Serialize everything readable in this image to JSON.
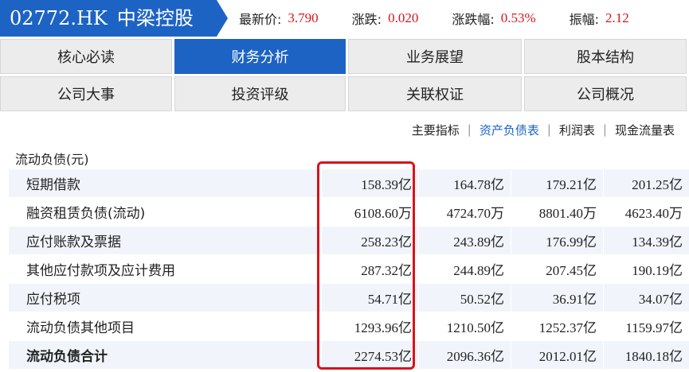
{
  "header": {
    "stock_code": "02772.HK",
    "stock_name": "中梁控股",
    "quotes": [
      {
        "label": "最新价:",
        "value": "3.790"
      },
      {
        "label": "涨跌:",
        "value": "0.020"
      },
      {
        "label": "涨跌幅:",
        "value": "0.53%"
      },
      {
        "label": "振幅:",
        "value": "2.12"
      }
    ]
  },
  "tabs": {
    "row1": [
      "核心必读",
      "财务分析",
      "业务展望",
      "股本结构"
    ],
    "row2": [
      "公司大事",
      "投资评级",
      "关联权证",
      "公司概况"
    ],
    "active": "财务分析"
  },
  "subnav": {
    "items": [
      "主要指标",
      "资产负债表",
      "利润表",
      "现金流量表"
    ],
    "separator": "|",
    "active": "资产负债表"
  },
  "table": {
    "section_title": "流动负债(元)",
    "rows": [
      {
        "label": "短期借款",
        "values": [
          "158.39亿",
          "164.78亿",
          "179.21亿",
          "201.25亿"
        ]
      },
      {
        "label": "融资租赁负债(流动)",
        "values": [
          "6108.60万",
          "4724.70万",
          "8801.40万",
          "4623.40万"
        ]
      },
      {
        "label": "应付账款及票据",
        "values": [
          "258.23亿",
          "243.89亿",
          "176.99亿",
          "134.39亿"
        ]
      },
      {
        "label": "其他应付款项及应计费用",
        "values": [
          "287.32亿",
          "244.89亿",
          "207.45亿",
          "190.19亿"
        ]
      },
      {
        "label": "应付税项",
        "values": [
          "54.71亿",
          "50.52亿",
          "36.91亿",
          "34.07亿"
        ]
      },
      {
        "label": "流动负债其他项目",
        "values": [
          "1293.96亿",
          "1210.50亿",
          "1252.37亿",
          "1159.97亿"
        ]
      },
      {
        "label": "流动负债合计",
        "values": [
          "2274.53亿",
          "2096.36亿",
          "2012.01亿",
          "1840.18亿"
        ]
      }
    ]
  },
  "colors": {
    "brand_blue": "#1d63c4",
    "up_red": "#d6171c",
    "highlight_red": "#d8131b"
  }
}
